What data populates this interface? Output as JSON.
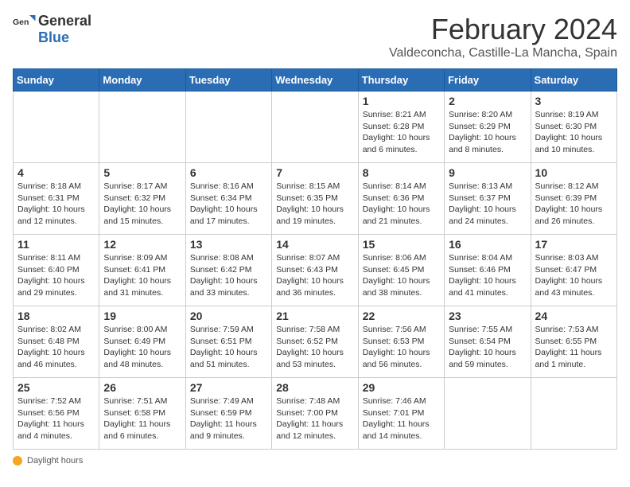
{
  "header": {
    "logo_general": "General",
    "logo_blue": "Blue",
    "month_title": "February 2024",
    "location": "Valdeconcha, Castille-La Mancha, Spain"
  },
  "weekdays": [
    "Sunday",
    "Monday",
    "Tuesday",
    "Wednesday",
    "Thursday",
    "Friday",
    "Saturday"
  ],
  "weeks": [
    [
      {
        "day": "",
        "info": ""
      },
      {
        "day": "",
        "info": ""
      },
      {
        "day": "",
        "info": ""
      },
      {
        "day": "",
        "info": ""
      },
      {
        "day": "1",
        "info": "Sunrise: 8:21 AM\nSunset: 6:28 PM\nDaylight: 10 hours and 6 minutes."
      },
      {
        "day": "2",
        "info": "Sunrise: 8:20 AM\nSunset: 6:29 PM\nDaylight: 10 hours and 8 minutes."
      },
      {
        "day": "3",
        "info": "Sunrise: 8:19 AM\nSunset: 6:30 PM\nDaylight: 10 hours and 10 minutes."
      }
    ],
    [
      {
        "day": "4",
        "info": "Sunrise: 8:18 AM\nSunset: 6:31 PM\nDaylight: 10 hours and 12 minutes."
      },
      {
        "day": "5",
        "info": "Sunrise: 8:17 AM\nSunset: 6:32 PM\nDaylight: 10 hours and 15 minutes."
      },
      {
        "day": "6",
        "info": "Sunrise: 8:16 AM\nSunset: 6:34 PM\nDaylight: 10 hours and 17 minutes."
      },
      {
        "day": "7",
        "info": "Sunrise: 8:15 AM\nSunset: 6:35 PM\nDaylight: 10 hours and 19 minutes."
      },
      {
        "day": "8",
        "info": "Sunrise: 8:14 AM\nSunset: 6:36 PM\nDaylight: 10 hours and 21 minutes."
      },
      {
        "day": "9",
        "info": "Sunrise: 8:13 AM\nSunset: 6:37 PM\nDaylight: 10 hours and 24 minutes."
      },
      {
        "day": "10",
        "info": "Sunrise: 8:12 AM\nSunset: 6:39 PM\nDaylight: 10 hours and 26 minutes."
      }
    ],
    [
      {
        "day": "11",
        "info": "Sunrise: 8:11 AM\nSunset: 6:40 PM\nDaylight: 10 hours and 29 minutes."
      },
      {
        "day": "12",
        "info": "Sunrise: 8:09 AM\nSunset: 6:41 PM\nDaylight: 10 hours and 31 minutes."
      },
      {
        "day": "13",
        "info": "Sunrise: 8:08 AM\nSunset: 6:42 PM\nDaylight: 10 hours and 33 minutes."
      },
      {
        "day": "14",
        "info": "Sunrise: 8:07 AM\nSunset: 6:43 PM\nDaylight: 10 hours and 36 minutes."
      },
      {
        "day": "15",
        "info": "Sunrise: 8:06 AM\nSunset: 6:45 PM\nDaylight: 10 hours and 38 minutes."
      },
      {
        "day": "16",
        "info": "Sunrise: 8:04 AM\nSunset: 6:46 PM\nDaylight: 10 hours and 41 minutes."
      },
      {
        "day": "17",
        "info": "Sunrise: 8:03 AM\nSunset: 6:47 PM\nDaylight: 10 hours and 43 minutes."
      }
    ],
    [
      {
        "day": "18",
        "info": "Sunrise: 8:02 AM\nSunset: 6:48 PM\nDaylight: 10 hours and 46 minutes."
      },
      {
        "day": "19",
        "info": "Sunrise: 8:00 AM\nSunset: 6:49 PM\nDaylight: 10 hours and 48 minutes."
      },
      {
        "day": "20",
        "info": "Sunrise: 7:59 AM\nSunset: 6:51 PM\nDaylight: 10 hours and 51 minutes."
      },
      {
        "day": "21",
        "info": "Sunrise: 7:58 AM\nSunset: 6:52 PM\nDaylight: 10 hours and 53 minutes."
      },
      {
        "day": "22",
        "info": "Sunrise: 7:56 AM\nSunset: 6:53 PM\nDaylight: 10 hours and 56 minutes."
      },
      {
        "day": "23",
        "info": "Sunrise: 7:55 AM\nSunset: 6:54 PM\nDaylight: 10 hours and 59 minutes."
      },
      {
        "day": "24",
        "info": "Sunrise: 7:53 AM\nSunset: 6:55 PM\nDaylight: 11 hours and 1 minute."
      }
    ],
    [
      {
        "day": "25",
        "info": "Sunrise: 7:52 AM\nSunset: 6:56 PM\nDaylight: 11 hours and 4 minutes."
      },
      {
        "day": "26",
        "info": "Sunrise: 7:51 AM\nSunset: 6:58 PM\nDaylight: 11 hours and 6 minutes."
      },
      {
        "day": "27",
        "info": "Sunrise: 7:49 AM\nSunset: 6:59 PM\nDaylight: 11 hours and 9 minutes."
      },
      {
        "day": "28",
        "info": "Sunrise: 7:48 AM\nSunset: 7:00 PM\nDaylight: 11 hours and 12 minutes."
      },
      {
        "day": "29",
        "info": "Sunrise: 7:46 AM\nSunset: 7:01 PM\nDaylight: 11 hours and 14 minutes."
      },
      {
        "day": "",
        "info": ""
      },
      {
        "day": "",
        "info": ""
      }
    ]
  ],
  "footer": {
    "daylight_label": "Daylight hours"
  }
}
